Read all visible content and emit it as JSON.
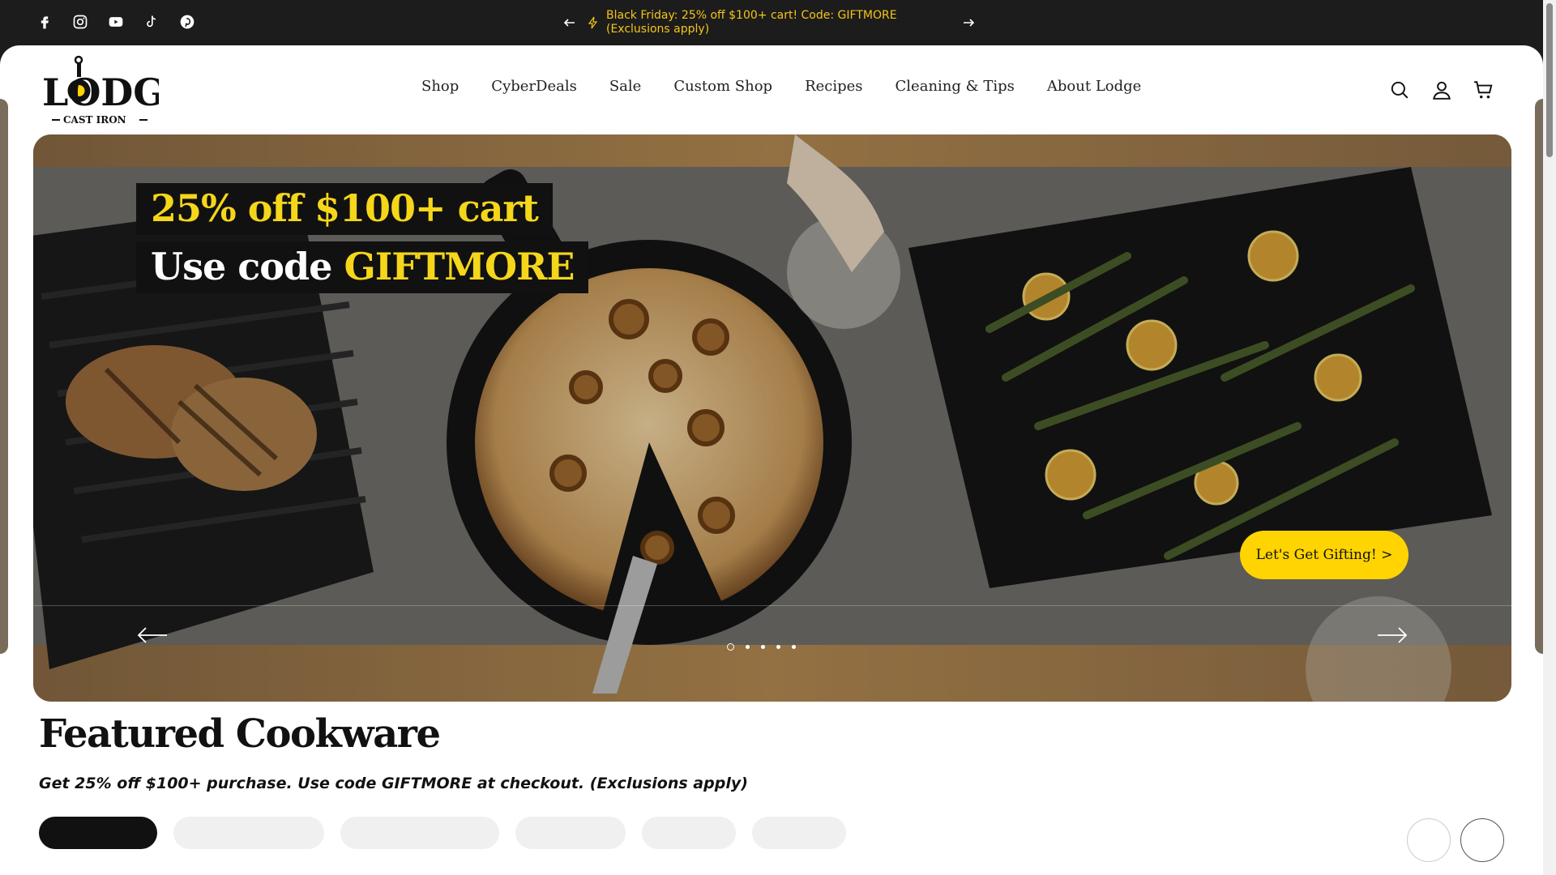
{
  "announcement": {
    "text": "Black Friday: 25% off $100+ cart! Code: GIFTMORE (Exclusions apply)"
  },
  "social": [
    "facebook-icon",
    "instagram-icon",
    "youtube-icon",
    "tiktok-icon",
    "pinterest-icon"
  ],
  "brand": {
    "name": "LODGE",
    "tagline": "CAST IRON"
  },
  "nav": {
    "items": [
      "Shop",
      "CyberDeals",
      "Sale",
      "Custom Shop",
      "Recipes",
      "Cleaning & Tips",
      "About Lodge"
    ]
  },
  "header_icons": [
    "search-icon",
    "account-icon",
    "cart-icon"
  ],
  "hero": {
    "line1": "25% off $100+ cart",
    "line2_prefix": "Use code ",
    "line2_code": "GIFTMORE",
    "cta": "Let's Get Gifting! >",
    "slides_total": 5,
    "active_slide": 1
  },
  "featured": {
    "title": "Featured Cookware",
    "subtitle": "Get 25% off $100+ purchase. Use code GIFTMORE at checkout. (Exclusions apply)"
  },
  "colors": {
    "accent": "#ffd400",
    "announcement_text": "#f5c518",
    "dark": "#1c1c1c"
  }
}
